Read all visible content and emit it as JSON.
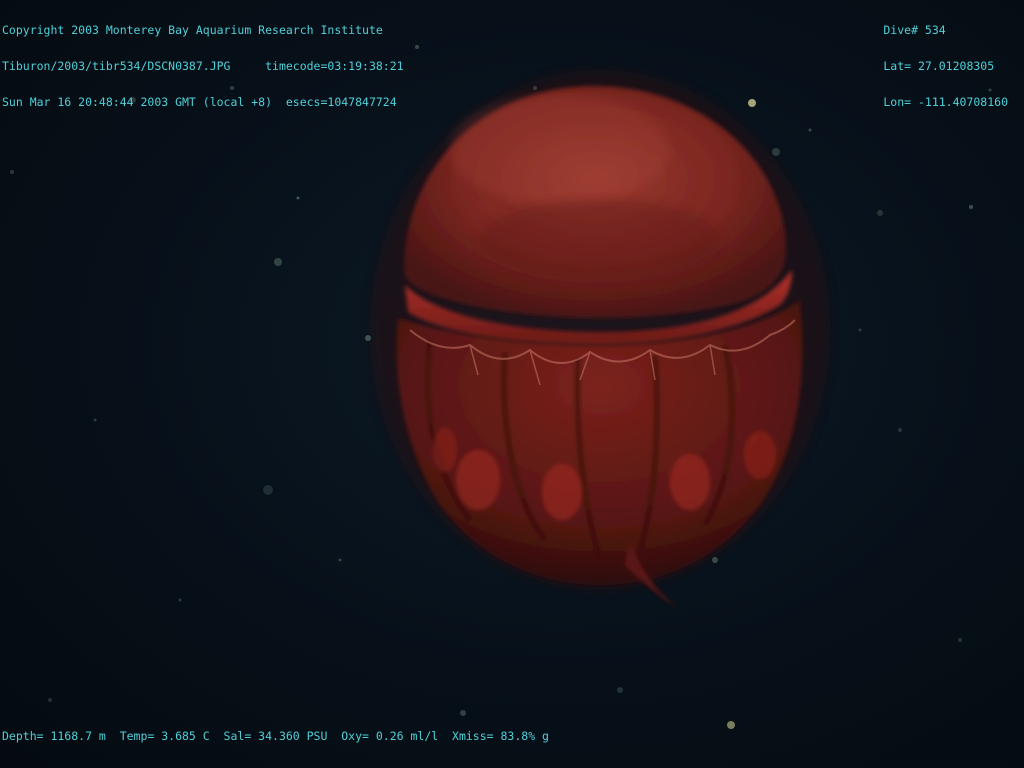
{
  "hud": {
    "top_left": {
      "copyright": "Copyright 2003 Monterey Bay Aquarium Research Institute",
      "file_line": "Tiburon/2003/tibr534/DSCN0387.JPG     timecode=03:19:38:21",
      "date_line": "Sun Mar 16 20:48:44 2003 GMT (local +8)  esecs=1047847724"
    },
    "top_right": {
      "dive": "Dive# 534",
      "lat": "Lat= 27.01208305",
      "lon": "Lon= -111.40708160"
    },
    "bottom": {
      "telemetry": "Depth= 1168.7 m  Temp= 3.685 C  Sal= 34.360 PSU  Oxy= 0.26 ml/l  Xmiss= 83.8% g"
    }
  },
  "image": {
    "subject_icon": "deep-sea-jellyfish",
    "background_color": "#06101a",
    "bell_color": "#8a2a22",
    "overlay_text_color": "#4fd0d8"
  }
}
